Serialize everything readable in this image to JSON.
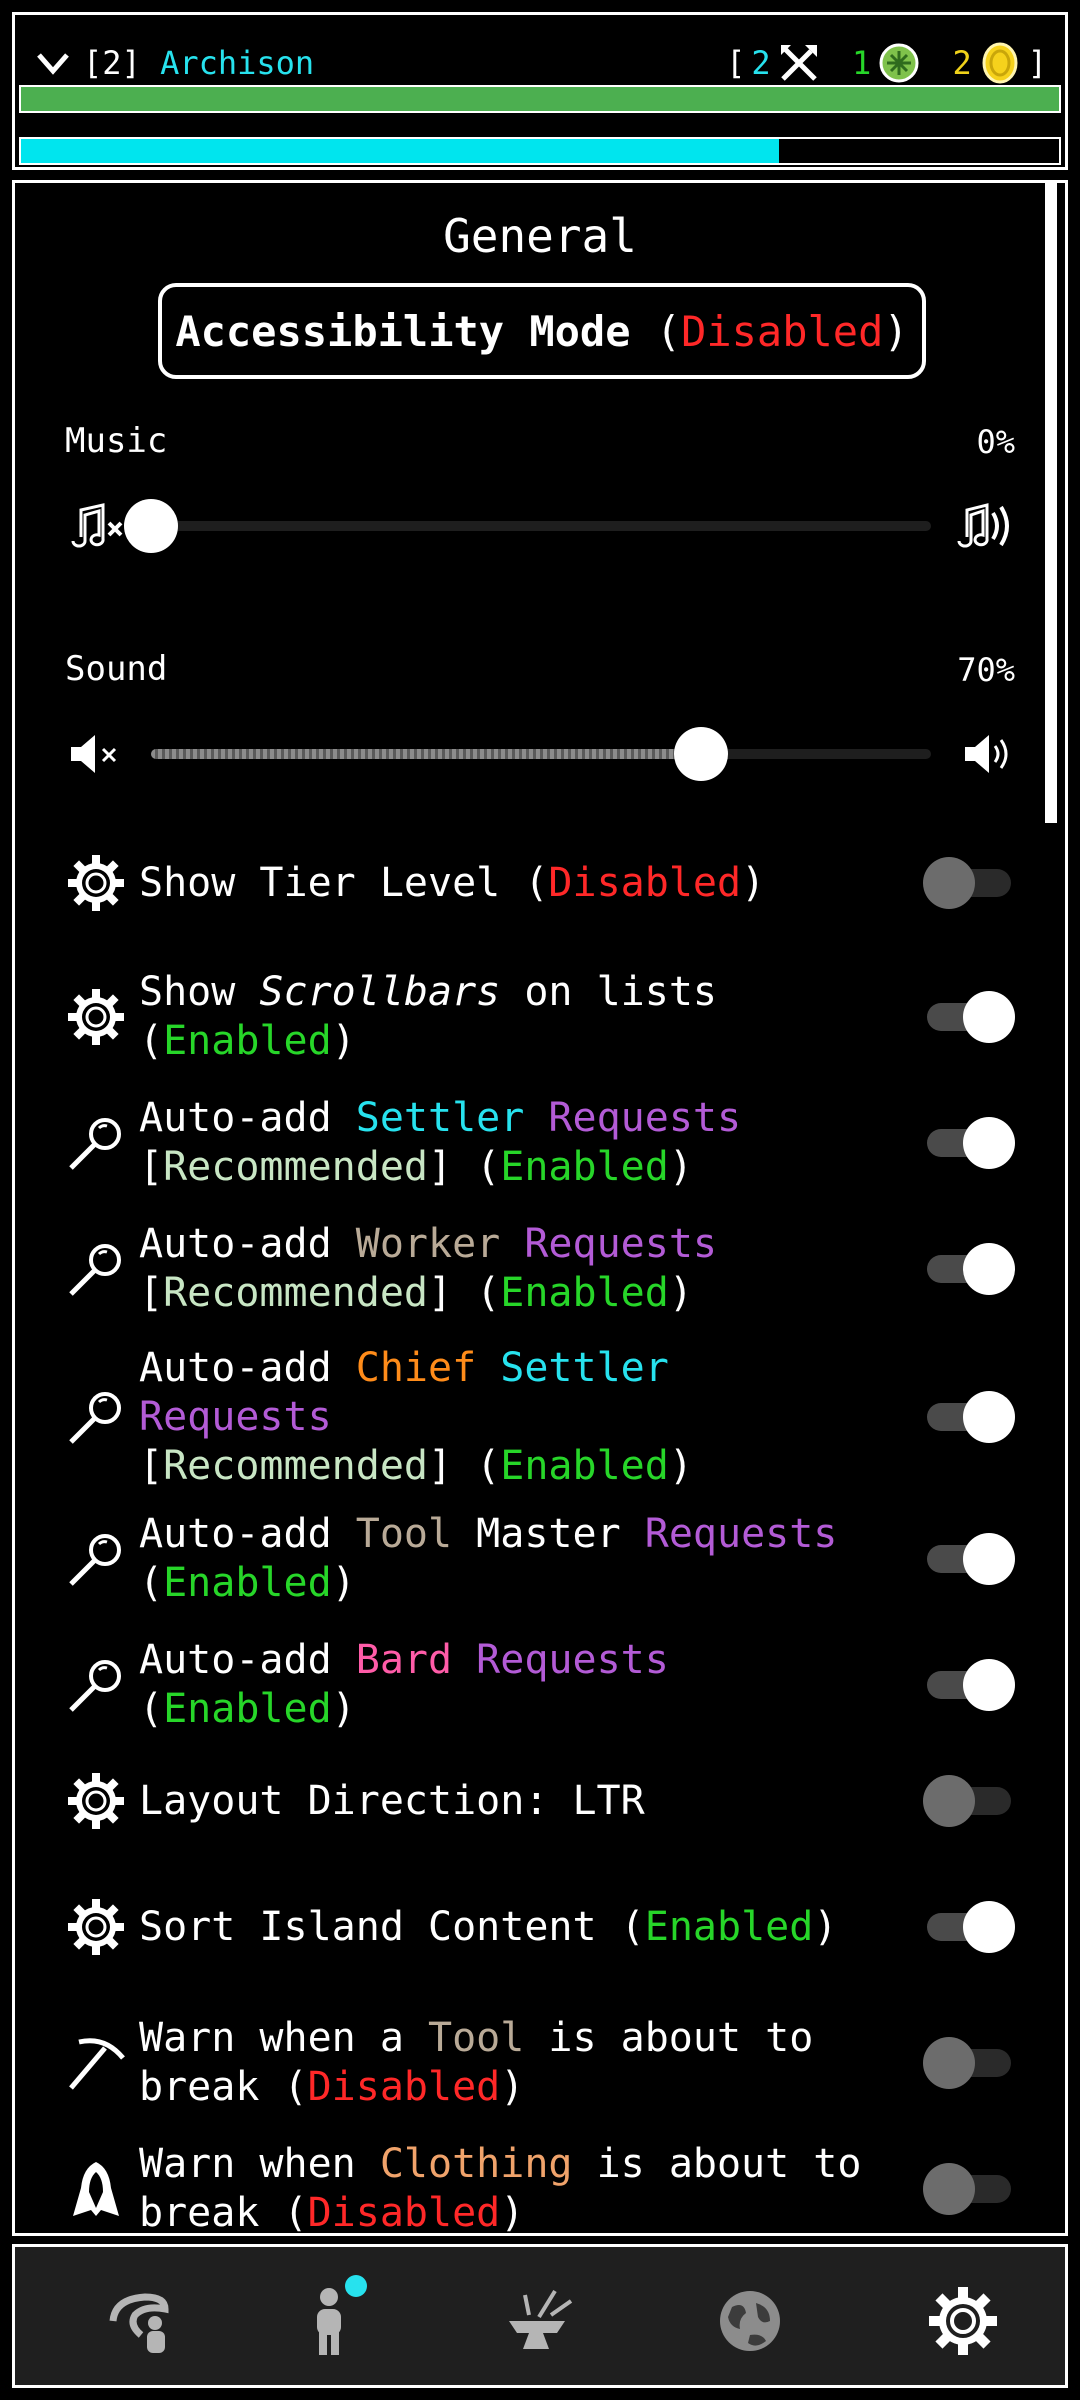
{
  "header": {
    "settlement_index": "[2]",
    "settlement_name": "Archison",
    "bracket_open": "[",
    "bracket_close": "]",
    "settler_count": "2",
    "worker_count": "1",
    "coin_count": "2",
    "health_fraction": 1.0,
    "progress_fraction": 0.73,
    "colors": {
      "health": "#4caf50",
      "progress": "#00e5ee"
    }
  },
  "general": {
    "title": "General",
    "accessibility": {
      "label": "Accessibility Mode",
      "open": "(",
      "state": "Disabled",
      "close": ")"
    },
    "music": {
      "label": "Music",
      "value_text": "0%",
      "value": 0
    },
    "sound": {
      "label": "Sound",
      "value_text": "70%",
      "value": 70
    }
  },
  "settings": [
    {
      "icon": "gear-icon",
      "on": false,
      "parts": [
        [
          "Show Tier Level ",
          "w"
        ],
        [
          "(",
          "w"
        ],
        [
          "Disabled",
          "red"
        ],
        [
          ")",
          "w"
        ]
      ]
    },
    {
      "icon": "gear-icon",
      "on": true,
      "parts": [
        [
          "Show ",
          "w"
        ],
        [
          "Scrollbars",
          "italic"
        ],
        [
          " on lists",
          "w"
        ],
        [
          "\n(",
          "w"
        ],
        [
          "Enabled",
          "green"
        ],
        [
          ")",
          "w"
        ]
      ]
    },
    {
      "icon": "magnifier-icon",
      "on": true,
      "parts": [
        [
          "Auto-add ",
          "w"
        ],
        [
          "Settler",
          "cyan"
        ],
        [
          " ",
          "w"
        ],
        [
          "Requests",
          "purple"
        ],
        [
          "\n[",
          "w"
        ],
        [
          "Recommended",
          "pale"
        ],
        [
          "] (",
          "w"
        ],
        [
          "Enabled",
          "green"
        ],
        [
          ")",
          "w"
        ]
      ]
    },
    {
      "icon": "magnifier-icon",
      "on": true,
      "parts": [
        [
          "Auto-add ",
          "w"
        ],
        [
          "Worker",
          "tan"
        ],
        [
          " ",
          "w"
        ],
        [
          "Requests",
          "purple"
        ],
        [
          "\n[",
          "w"
        ],
        [
          "Recommended",
          "pale"
        ],
        [
          "] (",
          "w"
        ],
        [
          "Enabled",
          "green"
        ],
        [
          ")",
          "w"
        ]
      ]
    },
    {
      "icon": "magnifier-icon",
      "on": true,
      "parts": [
        [
          "Auto-add ",
          "w"
        ],
        [
          "Chief",
          "orange"
        ],
        [
          " ",
          "w"
        ],
        [
          "Settler",
          "cyan"
        ],
        [
          "\n",
          "w"
        ],
        [
          "Requests",
          "purple"
        ],
        [
          "\n[",
          "w"
        ],
        [
          "Recommended",
          "pale"
        ],
        [
          "] (",
          "w"
        ],
        [
          "Enabled",
          "green"
        ],
        [
          ")",
          "w"
        ]
      ]
    },
    {
      "icon": "magnifier-icon",
      "on": true,
      "parts": [
        [
          "Auto-add ",
          "w"
        ],
        [
          "Tool",
          "tan"
        ],
        [
          " Master ",
          "w"
        ],
        [
          "Requests",
          "purple"
        ],
        [
          "\n(",
          "w"
        ],
        [
          "Enabled",
          "green"
        ],
        [
          ")",
          "w"
        ]
      ]
    },
    {
      "icon": "magnifier-icon",
      "on": true,
      "parts": [
        [
          "Auto-add ",
          "w"
        ],
        [
          "Bard",
          "pink"
        ],
        [
          " ",
          "w"
        ],
        [
          "Requests",
          "purple"
        ],
        [
          "\n(",
          "w"
        ],
        [
          "Enabled",
          "green"
        ],
        [
          ")",
          "w"
        ]
      ]
    },
    {
      "icon": "gear-icon",
      "on": false,
      "parts": [
        [
          "Layout Direction: LTR",
          "w"
        ]
      ]
    },
    {
      "icon": "gear-icon",
      "on": true,
      "parts": [
        [
          "Sort Island Content ",
          "w"
        ],
        [
          "(",
          "w"
        ],
        [
          "Enabled",
          "green"
        ],
        [
          ")",
          "w"
        ]
      ]
    },
    {
      "icon": "pickaxe-icon",
      "on": false,
      "parts": [
        [
          "Warn when a ",
          "w"
        ],
        [
          "Tool",
          "tan"
        ],
        [
          " is about to",
          "w"
        ],
        [
          "\nbreak (",
          "w"
        ],
        [
          "Disabled",
          "red"
        ],
        [
          ")",
          "w"
        ]
      ]
    },
    {
      "icon": "cloak-icon",
      "on": false,
      "parts": [
        [
          "Warn when ",
          "w"
        ],
        [
          "Clothing",
          "peach"
        ],
        [
          " is about to",
          "w"
        ],
        [
          "\nbreak (",
          "w"
        ],
        [
          "Disabled",
          "red"
        ],
        [
          ")",
          "w"
        ]
      ]
    }
  ],
  "bottom_nav": [
    {
      "icon": "expedition-icon",
      "active": false,
      "badge": false
    },
    {
      "icon": "settlers-icon",
      "active": false,
      "badge": true
    },
    {
      "icon": "crafting-icon",
      "active": false,
      "badge": false
    },
    {
      "icon": "world-icon",
      "active": false,
      "badge": false
    },
    {
      "icon": "settings-gear-icon",
      "active": true,
      "badge": false
    }
  ]
}
